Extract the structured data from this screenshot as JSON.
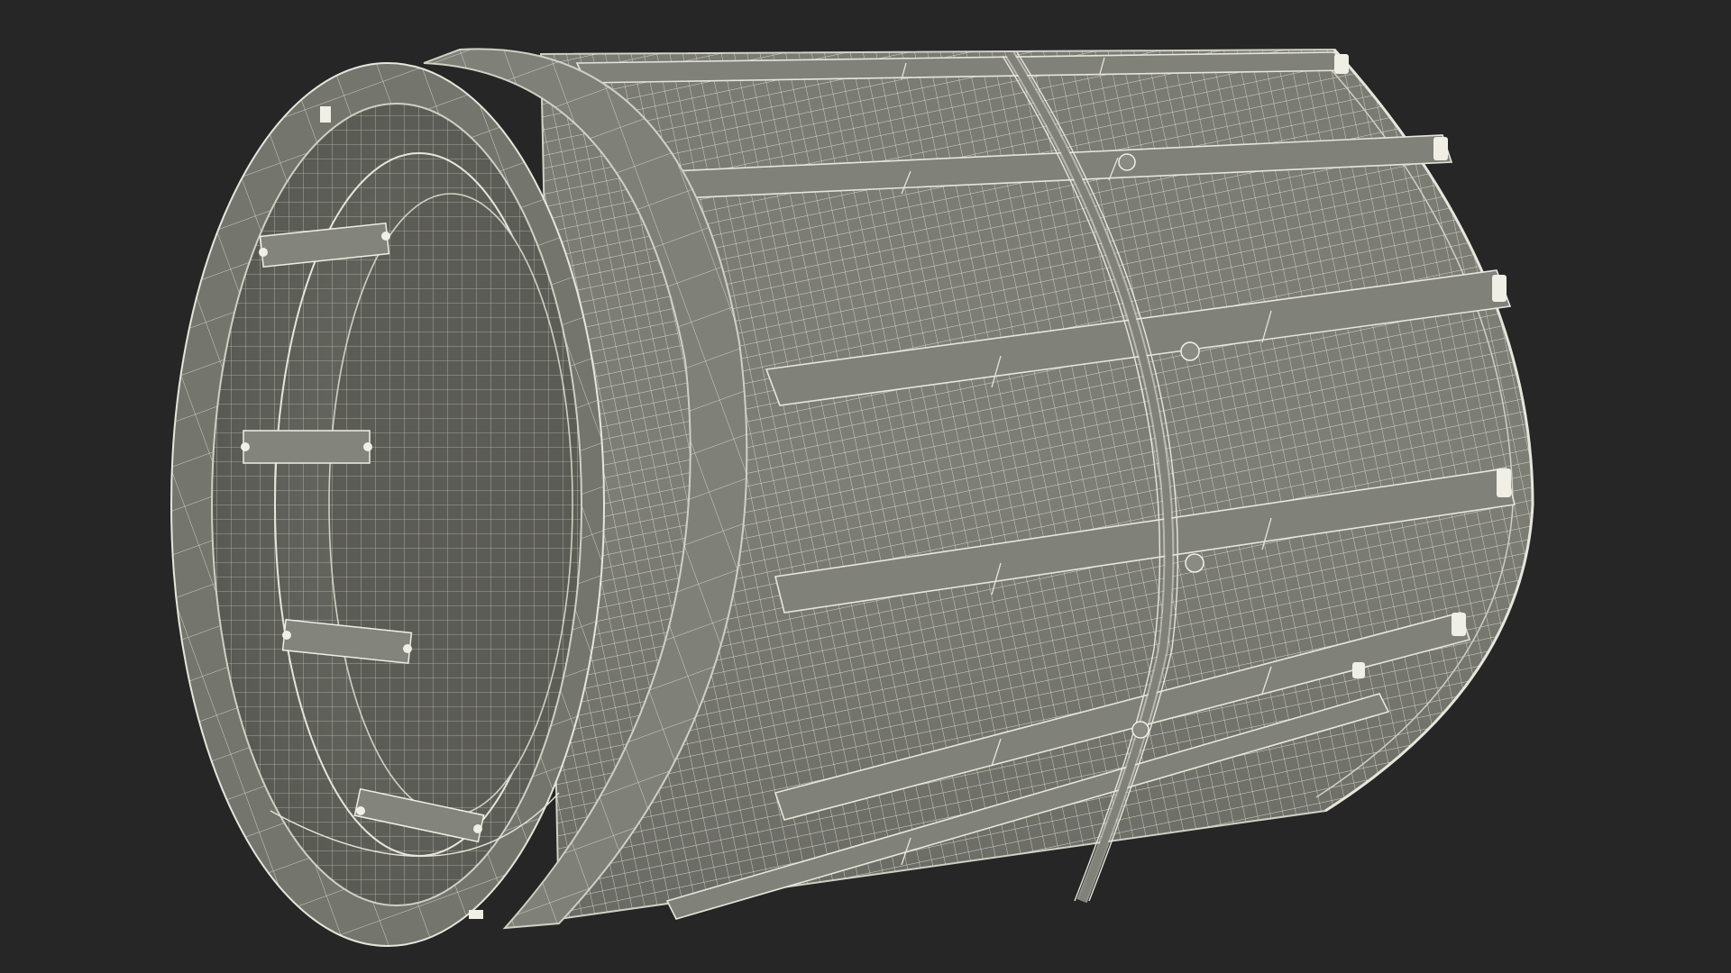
{
  "scene": {
    "object": "cylindrical-filter-basket-wireframe",
    "view": "3d-viewport",
    "colors": {
      "background": "#262626",
      "surface": "#76776f",
      "surface_dark": "#5e5f58",
      "surface_light": "#85867d",
      "inner_dark": "#55564f",
      "wire": "#e6e6dc",
      "edge": "#cfd0c4",
      "tab": "#efefe6"
    }
  }
}
